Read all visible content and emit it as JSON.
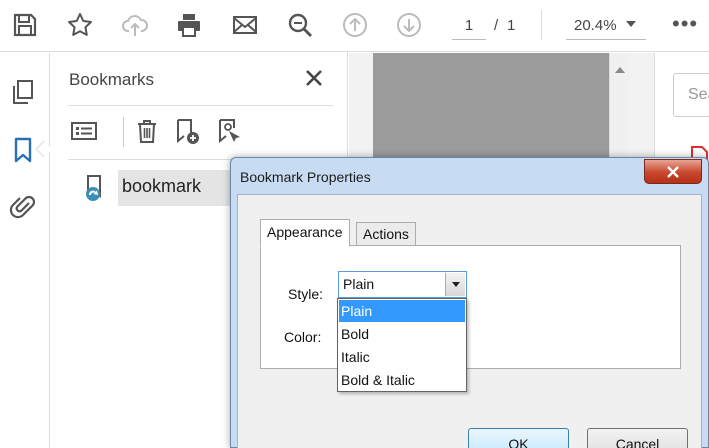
{
  "toolbar": {
    "page_current": "1",
    "page_separator": "/",
    "page_total": "1",
    "zoom": "20.4%",
    "more": "•••",
    "icons": [
      "save-icon",
      "star-icon",
      "cloud-upload-icon",
      "print-icon",
      "mail-icon",
      "zoom-search-icon",
      "prev-page-icon",
      "next-page-icon"
    ]
  },
  "left_rail": {
    "icons": [
      "pages-icon",
      "bookmark-icon",
      "attachment-icon"
    ],
    "active": "bookmark-icon"
  },
  "bookmarks_panel": {
    "title": "Bookmarks",
    "close": "✕",
    "items": [
      {
        "label": "bookmark"
      }
    ]
  },
  "right_pane": {
    "search_placeholder": "Search"
  },
  "dialog": {
    "title": "Bookmark Properties",
    "tabs": [
      {
        "label": "Appearance",
        "active": true
      },
      {
        "label": "Actions",
        "active": false
      }
    ],
    "style_label": "Style:",
    "color_label": "Color:",
    "style_value": "Plain",
    "style_options": [
      {
        "label": "Plain",
        "selected": true
      },
      {
        "label": "Bold",
        "selected": false
      },
      {
        "label": "Italic",
        "selected": false
      },
      {
        "label": "Bold & Italic",
        "selected": false
      }
    ],
    "ok_label": "OK",
    "cancel_label": "Cancel"
  },
  "colors": {
    "accent_blue": "#2a6fb7",
    "selection_blue": "#3399ff",
    "close_red": "#c7472d",
    "dialog_frame": "#c7dcf2"
  }
}
